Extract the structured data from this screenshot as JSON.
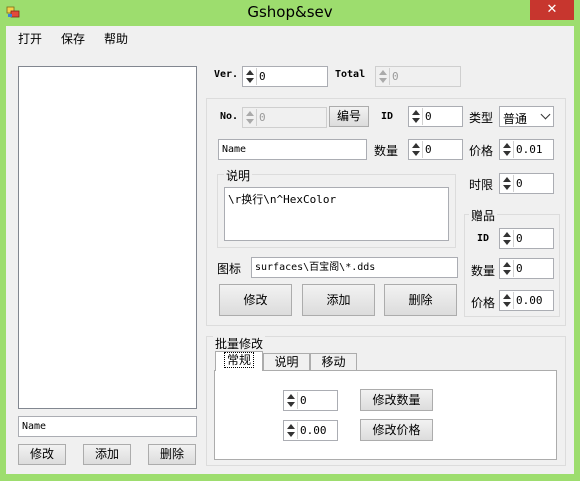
{
  "window": {
    "title": "Gshop&sev",
    "close_glyph": "✕"
  },
  "menu": [
    {
      "label": "打开"
    },
    {
      "label": "保存"
    },
    {
      "label": "帮助"
    }
  ],
  "left": {
    "name_field_value": "Name",
    "buttons": {
      "edit": "修改",
      "add": "添加",
      "delete": "删除"
    }
  },
  "header": {
    "ver_label": "Ver.",
    "ver_value": "0",
    "total_label": "Total",
    "total_value": "0"
  },
  "item": {
    "no_label": "No.",
    "no_value": "0",
    "number_button": "编号",
    "id_label": "ID",
    "id_value": "0",
    "type_label": "类型",
    "type_value": "普通",
    "name_value": "Name",
    "quantity_label": "数量",
    "quantity_value": "0",
    "price_label": "价格",
    "price_value": "0.01",
    "description_title": "说明",
    "description_text": "\\r换行\\n^HexColor",
    "time_limit_label": "时限",
    "time_limit_value": "0",
    "icon_label": "图标",
    "icon_path": "surfaces\\百宝阁\\*.dds",
    "buttons": {
      "edit": "修改",
      "add": "添加",
      "delete": "删除"
    }
  },
  "gift": {
    "title": "赠品",
    "id_label": "ID",
    "id_value": "0",
    "quantity_label": "数量",
    "quantity_value": "0",
    "price_label": "价格",
    "price_value": "0.00"
  },
  "batch": {
    "title": "批量修改",
    "tabs": [
      {
        "label": "常规",
        "active": true
      },
      {
        "label": "说明",
        "active": false
      },
      {
        "label": "移动",
        "active": false
      }
    ],
    "quantity_value": "0",
    "quantity_button": "修改数量",
    "price_value": "0.00",
    "price_button": "修改价格"
  },
  "colors": {
    "title_bar": "#9ddd6e",
    "close_button": "#c7362e",
    "client": "#f0f0f0"
  }
}
